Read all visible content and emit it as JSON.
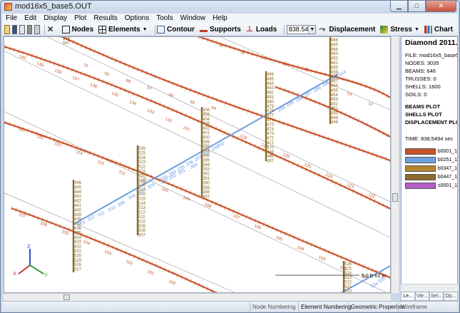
{
  "window": {
    "title": "mod16x5_base5.OUT"
  },
  "menu": [
    "File",
    "Edit",
    "Display",
    "Plot",
    "Results",
    "Options",
    "Tools",
    "Window",
    "Help"
  ],
  "toolbar": {
    "nodes": "Nodes",
    "elements": "Elements",
    "contour": "Contour",
    "supports": "Supports",
    "loads": "Loads",
    "time_value": "838.5494",
    "displacement": "Displacement",
    "stress": "Stress",
    "chart": "Chart"
  },
  "panel": {
    "title": "Diamond 2011.a.2",
    "file": "FILE: mod16x5_base5",
    "nodes": "NODES: 3035",
    "beams": "BEAMS: 646",
    "trusses": "TRUSSES: 0",
    "shells": "SHELLS: 1600",
    "soils": "SOILS: 0",
    "plot_lines": [
      "BEAMS PLOT",
      "SHELLS PLOT",
      "DISPLACEMENT PLOT"
    ],
    "time": "TIME: 838,5494 sec",
    "legend": [
      {
        "label": "b0001_1",
        "color": "#c8532a"
      },
      {
        "label": "b0251_1",
        "color": "#6e9ee0"
      },
      {
        "label": "b0347_1",
        "color": "#b7862c"
      },
      {
        "label": "b0447_1",
        "color": "#8c6a2e"
      },
      {
        "label": "s0001_1",
        "color": "#b45ec9"
      }
    ],
    "tabs": [
      "Le...",
      "Vie...",
      "Sel...",
      "Op..."
    ]
  },
  "plot": {
    "scale_label": "5,0 E-01 in",
    "axis": {
      "z": "Z",
      "x": "X",
      "y": "Y"
    },
    "label_colors": {
      "orange": "#c8532a",
      "blue": "#6e9ee0",
      "brown": "#8a6a2a"
    },
    "blue_labels": [
      "299",
      "298",
      "297",
      "296",
      "295",
      "294",
      "293",
      "292",
      "300",
      "301",
      "302",
      "303",
      "304",
      "305",
      "306",
      "309",
      "310",
      "311",
      "312",
      "313",
      "314",
      "284",
      "285",
      "286",
      "287",
      "288",
      "289",
      "290",
      "335",
      "334"
    ],
    "brown_labels_col1": [
      "446",
      "445",
      "444",
      "443",
      "442",
      "441",
      "440",
      "439",
      "438",
      "437",
      "436",
      "435",
      "434",
      "433",
      "432",
      "531",
      "530",
      "529",
      "528",
      "527"
    ],
    "brown_labels_col2": [
      "526",
      "525",
      "524",
      "523",
      "522",
      "521",
      "520",
      "519",
      "518",
      "517",
      "516",
      "515",
      "514",
      "513",
      "512",
      "511",
      "510",
      "509",
      "508",
      "507"
    ],
    "brown_labels_col3": [
      "406",
      "405",
      "404",
      "403",
      "402",
      "401",
      "400",
      "399",
      "398",
      "397",
      "396",
      "395",
      "394",
      "393",
      "392",
      "391",
      "390",
      "389",
      "388",
      "387"
    ],
    "brown_labels_col4": [
      "486",
      "485",
      "484",
      "483",
      "482",
      "481",
      "480",
      "479",
      "478",
      "477",
      "476",
      "475",
      "474",
      "473",
      "472",
      "471",
      "470",
      "469",
      "468",
      "467"
    ],
    "brown_labels_col5": [
      "466",
      "465",
      "464",
      "463",
      "462",
      "461",
      "460",
      "459",
      "458",
      "457",
      "456",
      "455",
      "454",
      "453",
      "452",
      "451",
      "450",
      "449",
      "448",
      "447"
    ],
    "brown_labels_col6": [
      "526",
      "525",
      "524",
      "523",
      "522",
      "521",
      "520"
    ],
    "top_labels": [
      "566",
      "567"
    ]
  },
  "status": {
    "node_numbering": "Node Numbering",
    "element_numbering": "Element Numbering",
    "geometric_properties": "Geometric Properties",
    "wireframe": "Wireframe"
  }
}
